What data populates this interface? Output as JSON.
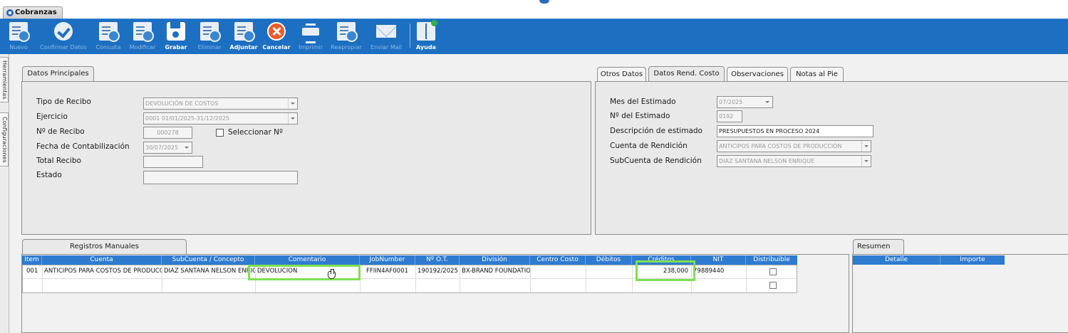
{
  "window_tab": {
    "label": "Cobranzas"
  },
  "toolbar": {
    "nuevo": "Nuevo",
    "confirmar": "Confirmar Datos",
    "consulta": "Consulta",
    "modificar": "Modificar",
    "grabar": "Grabar",
    "eliminar": "Eliminar",
    "adjuntar": "Adjuntar",
    "cancelar": "Cancelar",
    "imprimir": "Imprimir",
    "reapropiar": "Reapropiar",
    "enviar_mail": "Enviar Mail",
    "ayuda": "Ayuda"
  },
  "side_tabs": {
    "herramientas": "Herramientas",
    "configuraciones": "Configuraciones"
  },
  "datos_principales": {
    "tab": "Datos Principales",
    "tipo_recibo_label": "Tipo de Recibo",
    "tipo_recibo_value": "DEVOLUCIÓN DE COSTOS",
    "ejercicio_label": "Ejercicio",
    "ejercicio_value": "0001 01/01/2025-31/12/2025",
    "nro_recibo_label": "Nº de Recibo",
    "nro_recibo_value": "000278",
    "seleccionar_label": "Seleccionar Nº",
    "fecha_label": "Fecha de Contabilización",
    "fecha_value": "30/07/2025",
    "total_label": "Total Recibo",
    "total_value": "",
    "estado_label": "Estado",
    "estado_value": ""
  },
  "right_tabs": {
    "otros": "Otros Datos",
    "rend_costo": "Datos Rend. Costo",
    "observaciones": "Observaciones",
    "notas": "Notas al Pie"
  },
  "rend_costo": {
    "mes_label": "Mes del Estimado",
    "mes_value": "07/2025",
    "nro_label": "Nº del Estimado",
    "nro_value": "0192",
    "desc_label": "Descripción de estimado",
    "desc_value": "PRESUPUESTOS EN PROCESO 2024",
    "cuenta_label": "Cuenta de Rendición",
    "cuenta_value": "ANTICIPOS PARA COSTOS DE PRODUCCIÓN",
    "subcuenta_label": "SubCuenta de Rendición",
    "subcuenta_value": "DIAZ SANTANA NELSON ENRIQUE"
  },
  "registros": {
    "tab": "Registros Manuales",
    "columns": [
      "Item",
      "Cuenta",
      "SubCuenta / Concepto",
      "Comentario",
      "JobNumber",
      "Nº O.T.",
      "División",
      "Centro Costo",
      "Débitos",
      "Créditos",
      "NIT",
      "Distribuible"
    ],
    "rows": [
      {
        "item": "001",
        "cuenta": "ANTICIPOS PARA COSTOS DE PRODUCC",
        "subcuenta": "DIAZ SANTANA NELSON ENRIQ",
        "comentario": "DEVOLUCION",
        "jobnumber": "FFIIN4AF0001",
        "ot": "190192/2025",
        "division": "BX-BRAND FOUNDATION",
        "centro": "",
        "debitos": "",
        "creditos": "238,000",
        "nit": "79889440",
        "distribuible": false
      }
    ]
  },
  "resumen": {
    "tab": "Resumen",
    "columns": [
      "Detalle",
      "Importe"
    ]
  },
  "colors": {
    "toolbar": "#1d6fc2",
    "grid_header": "#2e7bd0",
    "highlight": "#7fe04f"
  }
}
